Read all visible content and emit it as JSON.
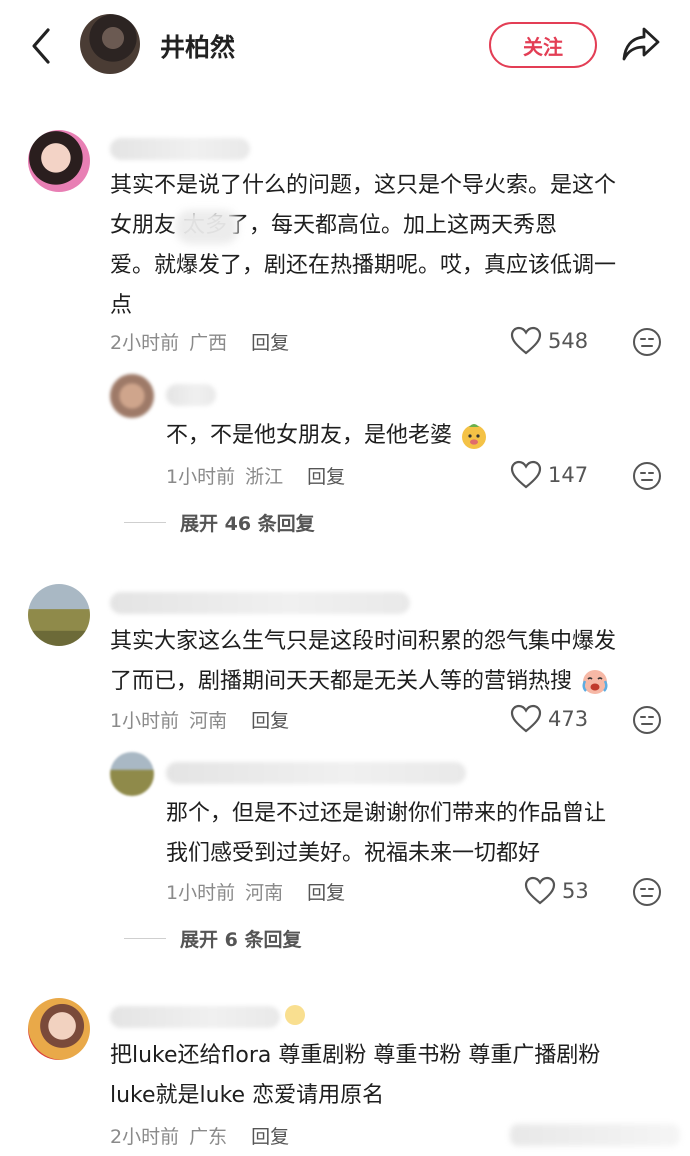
{
  "header": {
    "name": "井柏然",
    "follow_label": "关注"
  },
  "comments": [
    {
      "text": "其实不是说了什么的问题，这只是个导火索。是这个女朋友       太多了，每天都高位。加上这两天秀恩爱。就爆发了，剧还在热播期呢。哎，真应该低调一点",
      "lines": [
        "其实不是说了什么的问题，这只是个导火索。是这个",
        "女朋友        太多了，每天都高位。加上这两天秀恩",
        "爱。就爆发了，剧还在热播期呢。哎，真应该低调一",
        "点"
      ],
      "time": "2小时前",
      "location": "广西",
      "reply_label": "回复",
      "likes": "548",
      "replies": [
        {
          "text": "不，不是他女朋友，是他老婆",
          "time": "1小时前",
          "location": "浙江",
          "reply_label": "回复",
          "likes": "147"
        }
      ],
      "expand_label": "展开 46 条回复"
    },
    {
      "lines": [
        "其实大家这么生气只是这段时间积累的怨气集中爆发",
        "了而已，剧播期间天天都是无关人等的营销热搜"
      ],
      "time": "1小时前",
      "location": "河南",
      "reply_label": "回复",
      "likes": "473",
      "replies": [
        {
          "lines": [
            "那个，但是不过还是谢谢你们带来的作品曾让",
            "我们感受到过美好。祝福未来一切都好"
          ],
          "time": "1小时前",
          "location": "河南",
          "reply_label": "回复",
          "likes": "53"
        }
      ],
      "expand_label": "展开 6 条回复"
    },
    {
      "lines": [
        "把luke还给flora   尊重剧粉 尊重书粉 尊重广播剧粉",
        "luke就是luke  恋爱请用原名"
      ],
      "time": "2小时前",
      "location": "广东",
      "reply_label": "回复"
    }
  ],
  "icons": {
    "back": "chevron-left-icon",
    "share": "share-arrow-icon",
    "like": "heart-outline-icon",
    "emoji": "neutral-face-icon"
  },
  "colors": {
    "accent": "#e33e55",
    "meta": "#8a8a8a"
  }
}
